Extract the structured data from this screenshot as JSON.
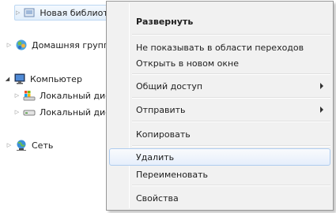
{
  "nav": {
    "library_item": "Новая библиотека",
    "homegroup": "Домашняя группа",
    "computer": "Компьютер",
    "local_disk_c": "Локальный диск (C:)",
    "local_disk_d": "Локальный диск (D:)",
    "network": "Сеть"
  },
  "menu": {
    "expand": "Развернуть",
    "hide_in_nav": "Не показывать в области переходов",
    "open_new_window": "Открыть в новом окне",
    "share": "Общий доступ",
    "send_to": "Отправить",
    "copy": "Копировать",
    "delete": "Удалить",
    "rename": "Переименовать",
    "properties": "Свойства"
  }
}
